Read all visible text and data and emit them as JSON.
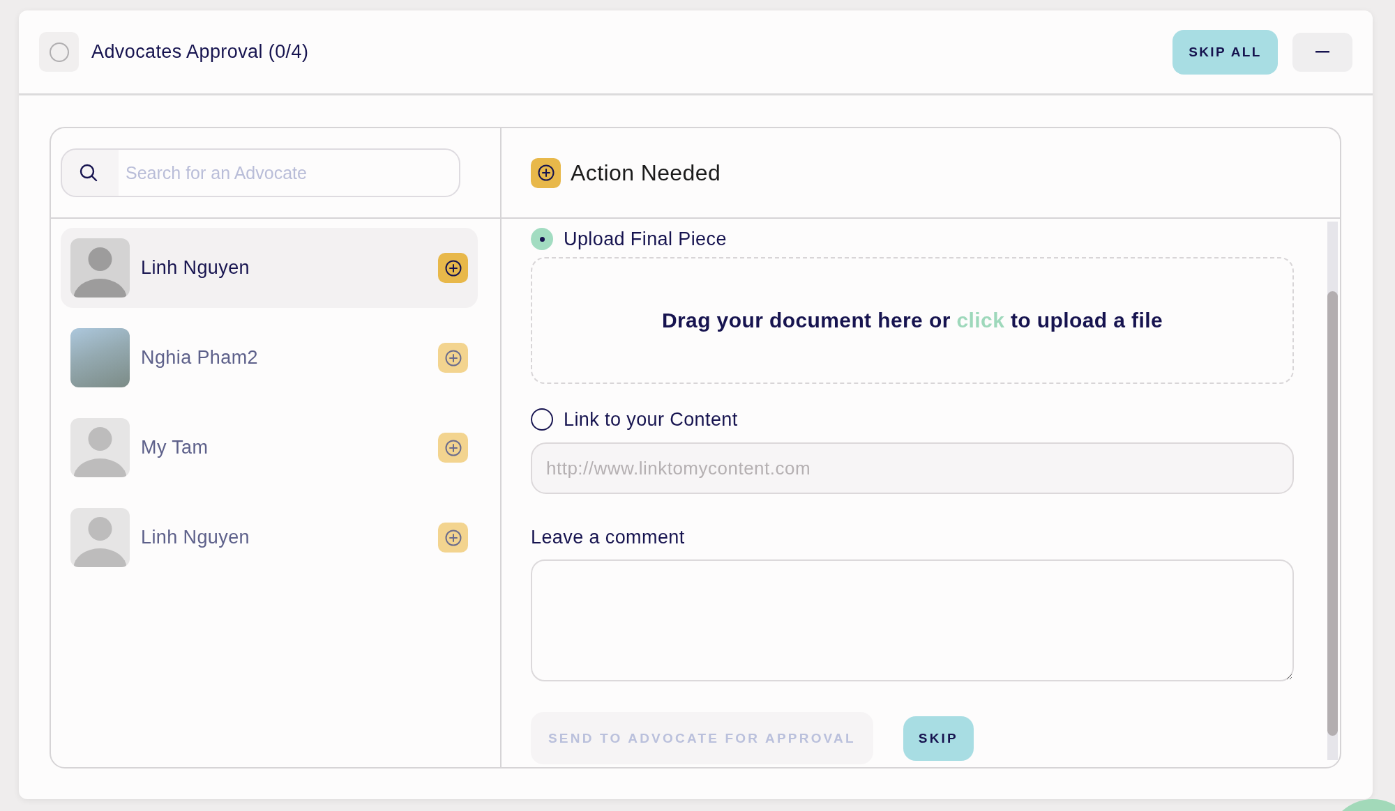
{
  "header": {
    "checked": false,
    "title": "Advocates Approval (0/4)",
    "skip_all": "SKIP ALL"
  },
  "search": {
    "placeholder": "Search for an Advocate"
  },
  "advocates": [
    {
      "name": "Linh Nguyen",
      "kind": "silhouette",
      "selected": true
    },
    {
      "name": "Nghia Pham2",
      "kind": "photo",
      "selected": false
    },
    {
      "name": "My Tam",
      "kind": "silhouette",
      "selected": false
    },
    {
      "name": "Linh Nguyen",
      "kind": "silhouette",
      "selected": false
    }
  ],
  "detail": {
    "title": "Action Needed",
    "options": [
      {
        "kind": "upload",
        "label": "Upload Final Piece",
        "selected": true,
        "dropzone": {
          "before": "Drag your document here or",
          "link": "click",
          "after": "to upload a file"
        }
      },
      {
        "kind": "link",
        "label": "Link to your Content",
        "selected": false,
        "placeholder": "http://www.linktomycontent.com"
      }
    ],
    "comment": {
      "label": "Leave a comment"
    },
    "actions": [
      {
        "label": "SEND TO ADVOCATE FOR APPROVAL",
        "disabled": true
      },
      {
        "label": "SKIP",
        "disabled": false
      }
    ]
  }
}
